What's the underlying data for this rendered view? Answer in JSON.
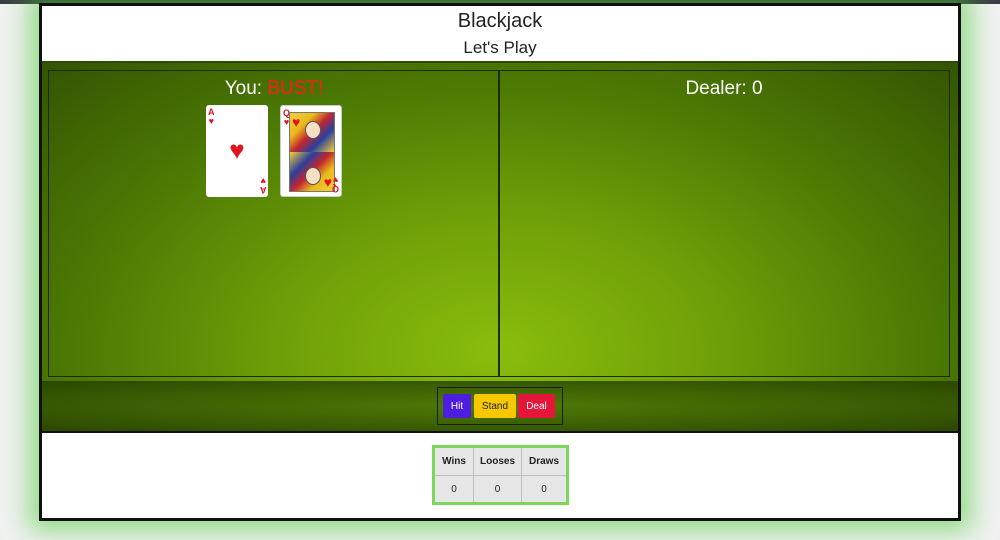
{
  "header": {
    "title": "Blackjack",
    "subtitle": "Let's Play"
  },
  "player": {
    "label": "You:",
    "status": "BUST!",
    "cards": [
      {
        "rank": "A",
        "suit": "♥",
        "name": "ace-of-hearts"
      },
      {
        "rank": "Q",
        "suit": "♥",
        "name": "queen-of-hearts"
      }
    ]
  },
  "dealer": {
    "label": "Dealer:",
    "score": "0"
  },
  "controls": {
    "hit_label": "Hit",
    "stand_label": "Stand",
    "deal_label": "Deal"
  },
  "scoreboard": {
    "headers": [
      "Wins",
      "Looses",
      "Draws"
    ],
    "values": [
      "0",
      "0",
      "0"
    ]
  },
  "colors": {
    "felt": "#6e9e08",
    "bust": "#ff1a1a",
    "hit": "#4e1ee0",
    "stand": "#f7c800",
    "deal": "#e6163a",
    "scoreboard_border": "#7bd65a"
  }
}
